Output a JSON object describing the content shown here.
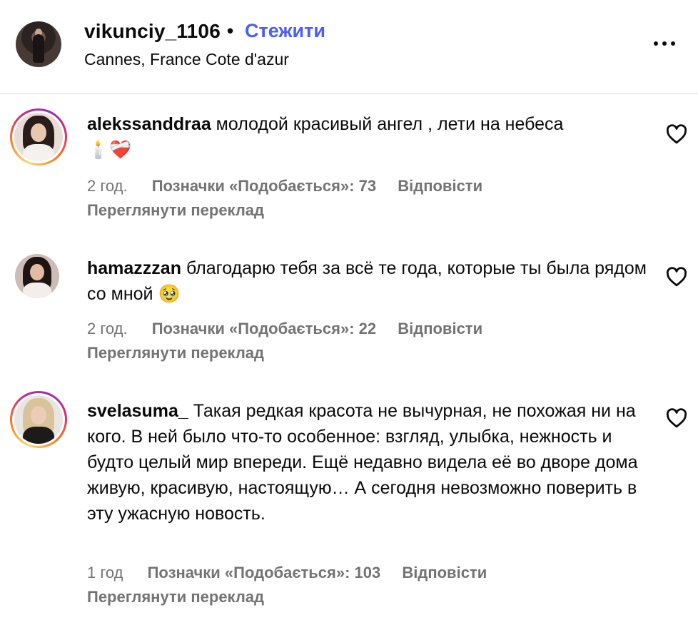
{
  "header": {
    "username": "vikunciy_1106",
    "separator": "•",
    "follow_label": "Стежити",
    "location": "Cannes, France Cote d'azur",
    "more_icon": "more-horizontal-icon"
  },
  "colors": {
    "follow": "#4a5df9",
    "meta_text": "#737373",
    "divider": "#dbdbdb"
  },
  "comments": [
    {
      "author": "alekssanddraa",
      "text": "молодой красивый ангел , лети на небеса",
      "emoji": "🕯️❤️‍🩹",
      "time": "2 год.",
      "likes": "Позначки «Подобається»: 73",
      "reply": "Відповісти",
      "translate": "Переглянути переклад",
      "has_story_ring": true
    },
    {
      "author": "hamazzzan",
      "text": "благодарю тебя за всё те года, которые ты была рядом со мной",
      "emoji": "🥹",
      "time": "2 год.",
      "likes": "Позначки «Подобається»: 22",
      "reply": "Відповісти",
      "translate": "Переглянути переклад",
      "has_story_ring": false
    },
    {
      "author": "svelasuma_",
      "text": "Такая редкая красота не вычурная, не похожая ни на кого. В ней было что-то особенное: взгляд, улыбка, нежность и будто целый мир впереди. Ещё недавно видела её во дворе дома живую, красивую, настоящую… А сегодня невозможно поверить в эту ужасную новость.",
      "time": "1 год",
      "likes": "Позначки «Подобається»: 103",
      "reply": "Відповісти",
      "translate": "Переглянути переклад",
      "has_story_ring": true
    }
  ]
}
